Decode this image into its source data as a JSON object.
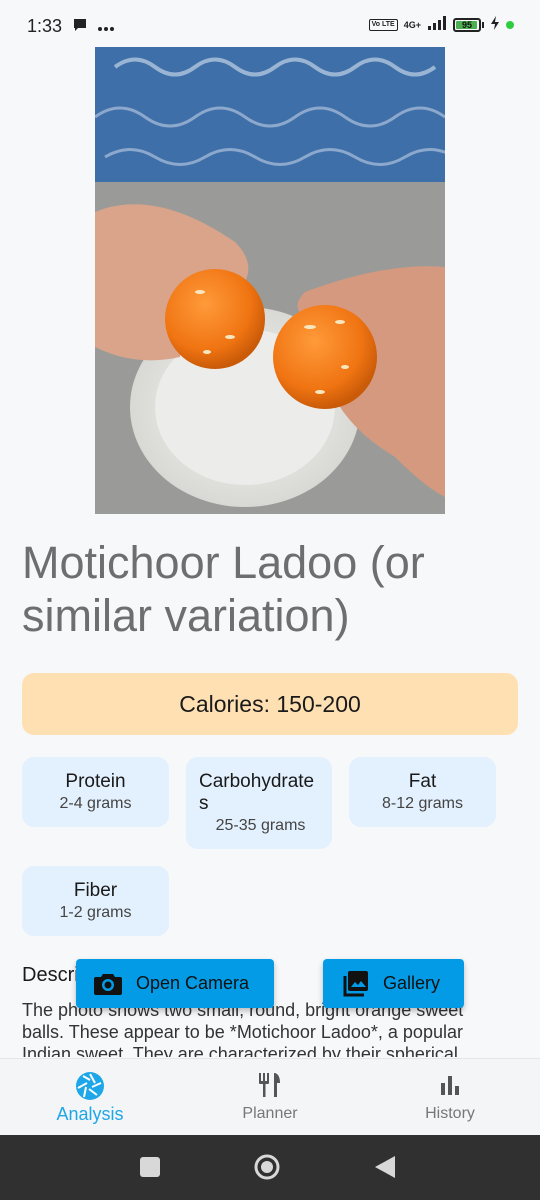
{
  "status_bar": {
    "time": "1:33",
    "network": "4G+",
    "volte": "Vo LTE",
    "battery": "95",
    "battery_level_percent": 95
  },
  "food": {
    "title": "Motichoor Ladoo (or similar variation)",
    "calories": "Calories: 150-200"
  },
  "nutrients": [
    {
      "label": "Protein",
      "value": "2-4 grams"
    },
    {
      "label": "Carbohydrates",
      "value": "25-35 grams"
    },
    {
      "label": "Fat",
      "value": "8-12 grams"
    },
    {
      "label": "Fiber",
      "value": "1-2 grams"
    }
  ],
  "description": {
    "heading": "Description",
    "text": "The photo shows two small, round, bright orange sweet balls.  These appear to be *Motichoor Ladoo*, a popular Indian sweet.  They are characterized by their spherical"
  },
  "actions": {
    "camera_label": "Open Camera",
    "gallery_label": "Gallery"
  },
  "bottom_nav": {
    "items": [
      {
        "label": "Analysis",
        "icon": "camera-shutter-icon",
        "active": true
      },
      {
        "label": "Planner",
        "icon": "restaurant-icon",
        "active": false
      },
      {
        "label": "History",
        "icon": "bar-chart-icon",
        "active": false
      }
    ]
  },
  "colors": {
    "accent": "#1ea7e8",
    "fab": "#039be5",
    "calories_bg": "#ffe0b3",
    "nutrient_bg": "#e3f0fd"
  }
}
